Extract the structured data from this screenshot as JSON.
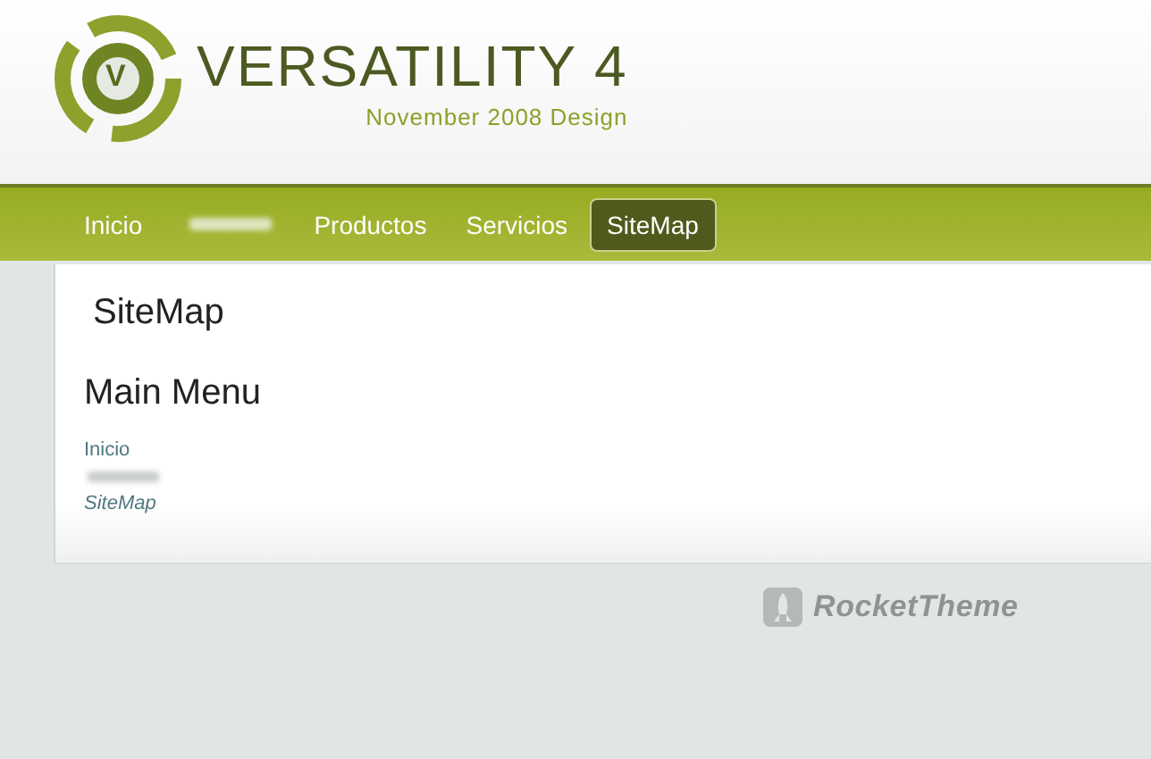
{
  "header": {
    "logo_letter": "V",
    "title": "VERSATILITY 4",
    "subtitle": "November 2008 Design"
  },
  "nav": [
    {
      "kind": "link",
      "label": "Inicio",
      "selected": false
    },
    {
      "kind": "redacted",
      "selected": false
    },
    {
      "kind": "link",
      "label": "Productos",
      "selected": false
    },
    {
      "kind": "link",
      "label": "Servicios",
      "selected": false
    },
    {
      "kind": "link",
      "label": "SiteMap",
      "selected": true
    }
  ],
  "page": {
    "title": "SiteMap",
    "menu_title": "Main Menu",
    "menu": [
      {
        "kind": "link",
        "label": "Inicio",
        "selected": false
      },
      {
        "kind": "redacted",
        "selected": false
      },
      {
        "kind": "link",
        "label": "SiteMap",
        "selected": true
      }
    ]
  },
  "footer": {
    "brand": "RocketTheme"
  }
}
